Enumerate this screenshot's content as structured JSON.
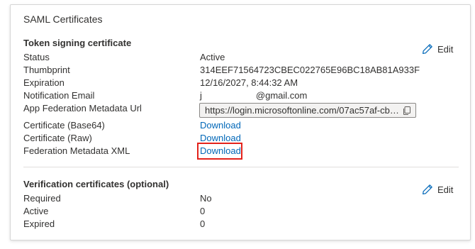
{
  "card": {
    "title": "SAML Certificates"
  },
  "token_section": {
    "title": "Token signing certificate",
    "edit_label": "Edit",
    "rows": [
      {
        "label": "Status",
        "value": "Active"
      },
      {
        "label": "Thumbprint",
        "value": "314EEF71564723CBEC022765E96BC18AB81A933F"
      },
      {
        "label": "Expiration",
        "value": "12/16/2027, 8:44:32 AM"
      },
      {
        "label": "Notification Email",
        "value_prefix": "j",
        "value_suffix": "@gmail.com"
      },
      {
        "label": "App Federation Metadata Url",
        "value": "https://login.microsoftonline.com/07ac57af-cb91-..."
      },
      {
        "label": "Certificate (Base64)",
        "value": "Download"
      },
      {
        "label": "Certificate (Raw)",
        "value": "Download"
      },
      {
        "label": "Federation Metadata XML",
        "value": "Download"
      }
    ]
  },
  "verification_section": {
    "title": "Verification certificates (optional)",
    "edit_label": "Edit",
    "rows": [
      {
        "label": "Required",
        "value": "No"
      },
      {
        "label": "Active",
        "value": "0"
      },
      {
        "label": "Expired",
        "value": "0"
      }
    ]
  },
  "colors": {
    "link": "#0067b8",
    "highlight": "#e3221b"
  },
  "icons": {
    "edit": "pencil-icon",
    "copy": "copy-icon"
  }
}
